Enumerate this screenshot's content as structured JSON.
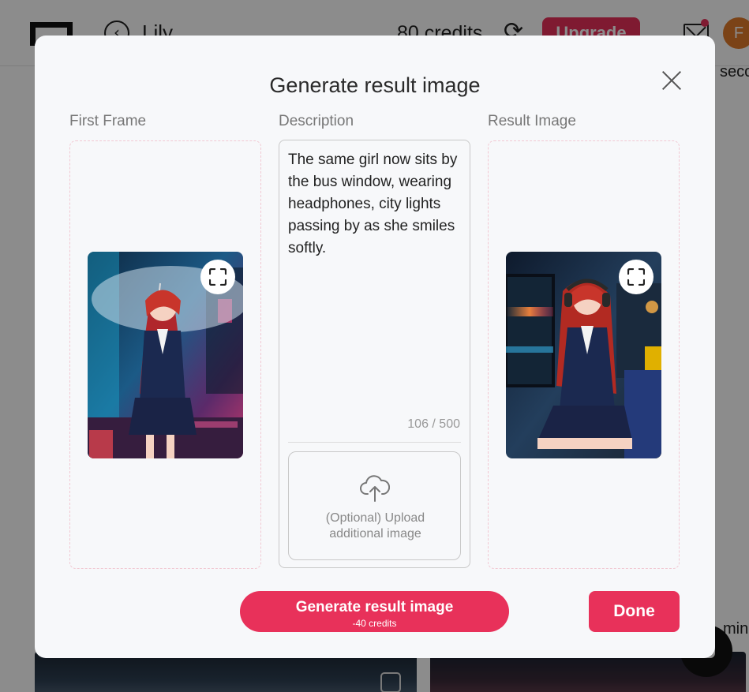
{
  "app": {
    "name": "Lily",
    "credits": "80 credits",
    "upgrade_label": "Upgrade",
    "avatar_initial": "F",
    "side_text_top": "seco",
    "side_text_bottom": "min",
    "accent_color": "#e8315a"
  },
  "modal": {
    "title": "Generate result image",
    "first_frame_label": "First Frame",
    "description_label": "Description",
    "result_label": "Result Image",
    "description_text": "The same girl now sits by the bus window, wearing headphones, city lights passing by as she smiles softly.",
    "char_count": "106 / 500",
    "upload_text_line1": "(Optional) Upload",
    "upload_text_line2": "additional image",
    "generate_label": "Generate result image",
    "generate_cost": "-40 credits",
    "done_label": "Done"
  },
  "icons": {
    "close": "close-icon",
    "expand": "expand-icon",
    "upload": "cloud-upload-icon"
  }
}
